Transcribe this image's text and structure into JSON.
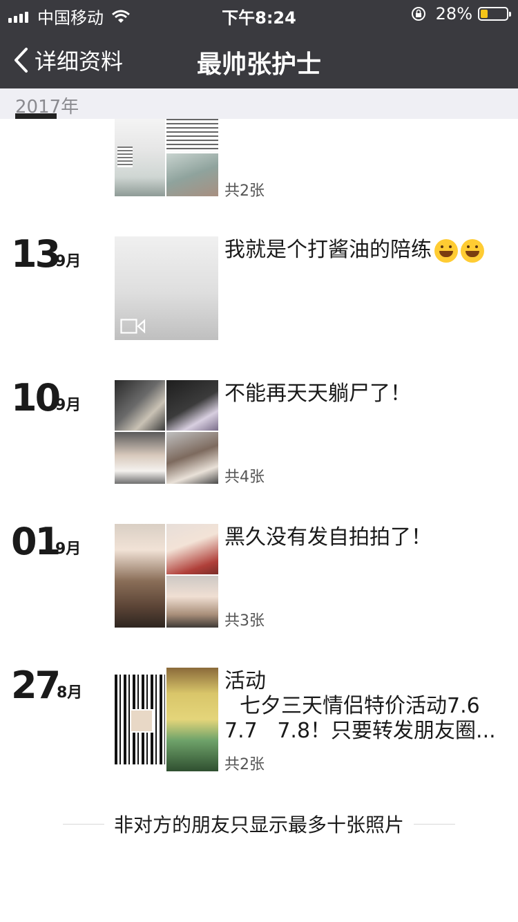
{
  "status_bar": {
    "carrier": "中国移动",
    "time": "下午8:24",
    "battery": "28%",
    "battery_level": 0.28
  },
  "nav": {
    "back_label": "详细资料",
    "title": "最帅张护士"
  },
  "year_header": "2017年",
  "top_post": {
    "count": "共2张"
  },
  "posts": [
    {
      "day": "13",
      "month": "9月",
      "text": "我就是个打酱油的陪练",
      "emoji_count": 2,
      "count": "",
      "media": "video"
    },
    {
      "day": "10",
      "month": "9月",
      "text": "不能再天天躺尸了！",
      "count": "共4张",
      "media": "photos-4"
    },
    {
      "day": "01",
      "month": "9月",
      "text": "黑久没有发自拍拍了！",
      "count": "共3张",
      "media": "photos-3"
    },
    {
      "day": "27",
      "month": "8月",
      "text_line1": "活动",
      "text_line2": "七夕三天情侣特价活动7.6",
      "text_line3": "7.7   7.8！只要转发朋友圈...",
      "count": "共2张",
      "media": "photos-2"
    }
  ],
  "footer_note": "非对方的朋友只显示最多十张照片",
  "colors": {
    "header_bg": "#3a3a3f",
    "year_bar_bg": "#efeff4",
    "battery_fill": "#f5c518"
  }
}
